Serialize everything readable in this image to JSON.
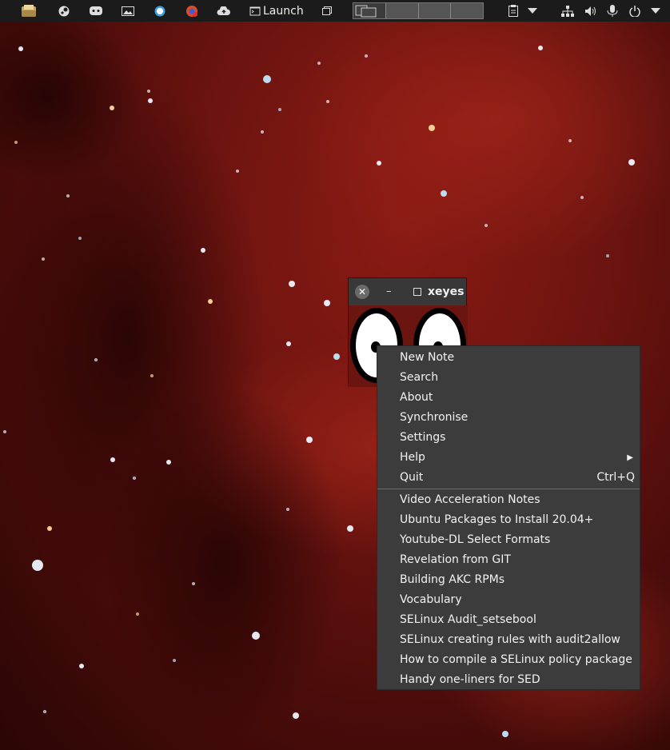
{
  "panel": {
    "launch_label": "Launch",
    "icons": [
      "file-manager-icon",
      "steam-icon",
      "discord-icon",
      "screenshot-icon",
      "chat-icon",
      "browser-icon",
      "cloud-upload-icon",
      "terminal-icon",
      "window-icon",
      "clipboard-icon",
      "chevron-down-icon",
      "network-icon",
      "volume-icon",
      "microphone-icon",
      "power-icon"
    ],
    "workspaces": 4
  },
  "xeyes": {
    "title": "xeyes",
    "close_glyph": "✕",
    "minimize_glyph": "–"
  },
  "menu": {
    "items": [
      {
        "label": "New Note"
      },
      {
        "label": "Search"
      },
      {
        "label": "About"
      },
      {
        "label": "Synchronise"
      },
      {
        "label": "Settings"
      },
      {
        "label": "Help",
        "submenu": true
      },
      {
        "label": "Quit",
        "accel": "Ctrl+Q"
      }
    ],
    "notes": [
      {
        "label": "Video Acceleration Notes"
      },
      {
        "label": "Ubuntu Packages to Install 20.04+"
      },
      {
        "label": "Youtube-DL Select Formats"
      },
      {
        "label": "Revelation from GIT"
      },
      {
        "label": "Building AKC RPMs"
      },
      {
        "label": "Vocabulary"
      },
      {
        "label": "SELinux Audit_setsebool"
      },
      {
        "label": "SELinux creating rules with audit2allow"
      },
      {
        "label": "How to compile a SELinux policy package"
      },
      {
        "label": "Handy one-liners for SED"
      }
    ]
  },
  "colors": {
    "panel_bg": "#1b1b1b",
    "menu_bg": "#3c3c3c",
    "wallpaper_red": "#7a1510"
  }
}
